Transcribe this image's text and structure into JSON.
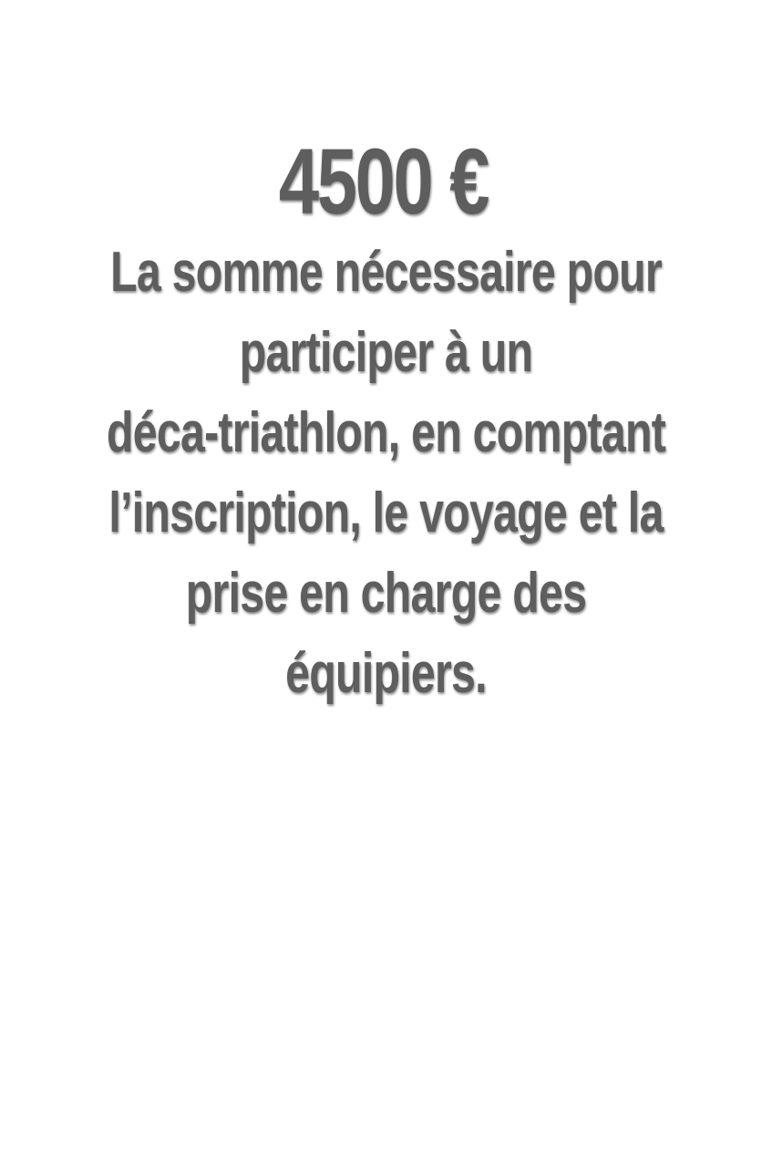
{
  "amount": "4500 €",
  "caption_lines": [
    "La somme nécessaire pour",
    "participer à un",
    "déca-triathlon, en comptant",
    "l’inscription, le voyage et la",
    "prise en charge des",
    "équipiers."
  ],
  "colors": {
    "text": "#5e5e5e",
    "background": "#ffffff"
  }
}
